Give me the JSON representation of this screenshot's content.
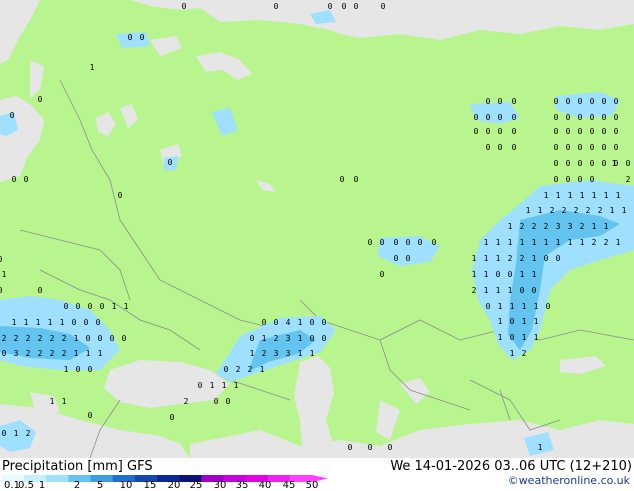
{
  "map": {
    "colors": {
      "land": "#b8f58e",
      "non_forecast_land": "#e6e6e6",
      "water": "#e6e6e6",
      "border": "#8c8c8c",
      "light_precip": "#9fe0ff",
      "moderate_precip": "#63c4f0",
      "marker": "#000000"
    }
  },
  "legend": {
    "title": "Precipitation [mm]",
    "model": "GFS",
    "datetime": "We 14-01-2026 03..06 UTC (12+210)",
    "credit": "©weatheronline.co.uk",
    "ticks": [
      "0.1",
      "0.5",
      "1",
      "2",
      "5",
      "10",
      "15",
      "20",
      "25",
      "30",
      "35",
      "40",
      "45",
      "50"
    ],
    "scale_colors": [
      "#e6faff",
      "#c4f0ff",
      "#9fe0ff",
      "#63c4f0",
      "#3aa0e0",
      "#1e6ed2",
      "#1446b4",
      "#0a2896",
      "#0a1478",
      "#a000c8",
      "#c800dc",
      "#e600e6",
      "#f020f0",
      "#ff40ff"
    ]
  },
  "groups": {
    "arctic_north_coast": [
      "0",
      "0",
      "0",
      "0",
      "0",
      "0"
    ],
    "siberia_ne_cluster": [
      "0",
      "0",
      "0",
      "0",
      "0",
      "0",
      "0",
      "0",
      "0",
      "0",
      "0",
      "0",
      "0",
      "0",
      "0",
      "0",
      "0",
      "0",
      "0",
      "0",
      "0",
      "0",
      "0",
      "0",
      "0",
      "0",
      "0",
      "0",
      "0",
      "0",
      "0",
      "0",
      "0",
      "0",
      "0",
      "0",
      "0",
      "0",
      "0",
      "0",
      "0",
      "0",
      "0",
      "0",
      "0",
      "0",
      "0",
      "0",
      "0",
      "0"
    ],
    "siberia_rain_band": [
      "1",
      "1",
      "1",
      "1",
      "1",
      "1",
      "1",
      "1",
      "1",
      "2",
      "2",
      "2",
      "2",
      "2",
      "1",
      "1",
      "1",
      "2",
      "2",
      "2",
      "3",
      "3",
      "2",
      "1",
      "1",
      "1",
      "1",
      "1",
      "1",
      "1",
      "1",
      "1",
      "1",
      "1",
      "2",
      "2",
      "1",
      "1",
      "1",
      "1",
      "2",
      "2",
      "1",
      "0",
      "0",
      "1",
      "1",
      "0",
      "0",
      "1",
      "1",
      "2",
      "1",
      "1",
      "1",
      "0",
      "0",
      "0",
      "1",
      "1",
      "1",
      "1",
      "0",
      "1",
      "0",
      "1",
      "1",
      "1",
      "0",
      "1",
      "1",
      "1",
      "2"
    ],
    "ural_row": [
      "0",
      "0",
      "0",
      "0",
      "0",
      "0"
    ],
    "ural_row2": [
      "0",
      "0",
      "0",
      "0"
    ],
    "balkans_block": [
      "0",
      "0",
      "0",
      "0",
      "1",
      "1",
      "1",
      "1",
      "1",
      "1",
      "1",
      "0",
      "0",
      "0",
      "2",
      "2",
      "2",
      "2",
      "2",
      "2",
      "1",
      "0",
      "0",
      "0",
      "0",
      "0",
      "3",
      "2",
      "2",
      "2",
      "2",
      "1",
      "1",
      "1",
      "1",
      "0",
      "0",
      "1",
      "1",
      "1"
    ],
    "caucasus_block": [
      "0",
      "0",
      "4",
      "1",
      "0",
      "0",
      "0",
      "1",
      "2",
      "3",
      "1",
      "0",
      "0",
      "1",
      "2",
      "3",
      "3",
      "1",
      "1",
      "0",
      "2",
      "2",
      "1",
      "0",
      "1",
      "1",
      "1",
      "0",
      "0"
    ],
    "baltic": [
      "0",
      "0",
      "0",
      "0",
      "0",
      "1",
      "0"
    ],
    "misc_singletons": [
      "0",
      "0",
      "0",
      "0",
      "0",
      "0",
      "0",
      "0",
      "1",
      "2",
      "0",
      "0",
      "0",
      "1",
      "1",
      "2",
      "2",
      "0"
    ]
  }
}
